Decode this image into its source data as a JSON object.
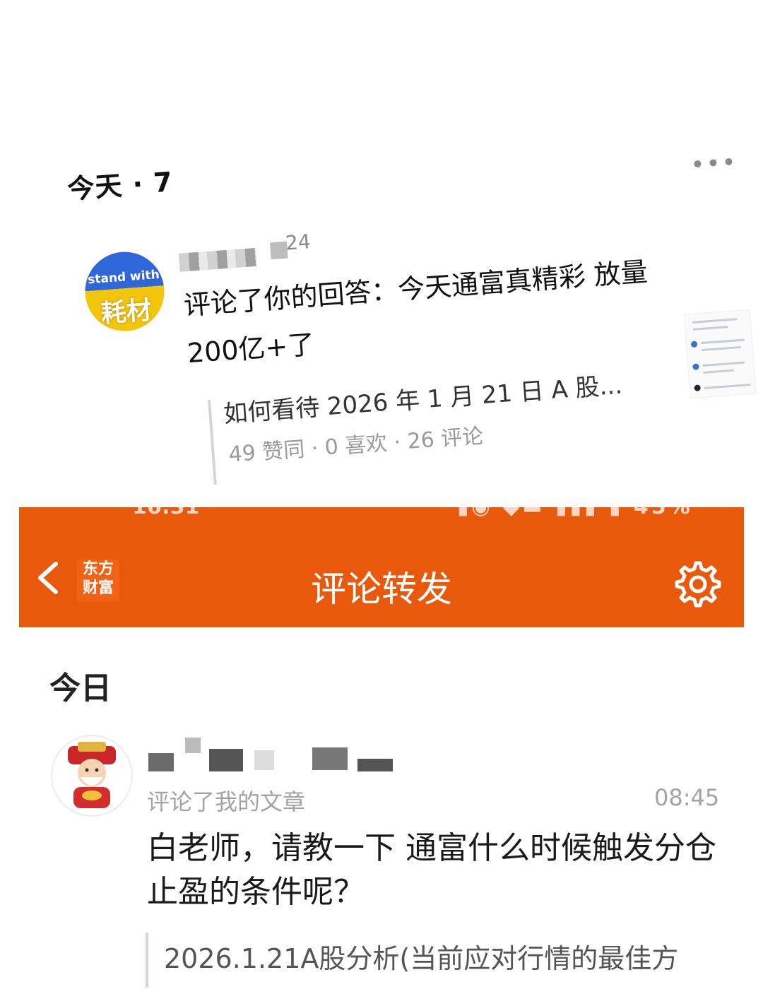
{
  "top_panel": {
    "day_label": "今天 · 7",
    "more_icon": "more-horizontal-icon",
    "badge_line1": "stand with",
    "badge_line2": "耗材",
    "time": "24",
    "comment": "评论了你的回答：今天通富真精彩 放量200亿+了",
    "quoted_title": "如何看待 2026 年 1 月 21 日 A 股...",
    "quoted_stats": "49 赞同 · 0 喜欢 · 26 评论"
  },
  "app": {
    "header_title": "评论转发",
    "logo_text_line1": "东方",
    "logo_text_line2": "财富",
    "back_icon": "chevron-left-icon",
    "settings_icon": "gear-icon",
    "section_label": "今日",
    "notification": {
      "action": "评论了我的文章",
      "time": "08:45",
      "comment": "白老师，请教一下  通富什么时候触发分仓止盈的条件呢？",
      "quoted_title": "2026.1.21A股分析(当前应对行情的最佳方"
    }
  },
  "colors": {
    "header_bg": "#e9590c",
    "badge_blue": "#2f66d8",
    "badge_yellow": "#f2c60c"
  }
}
